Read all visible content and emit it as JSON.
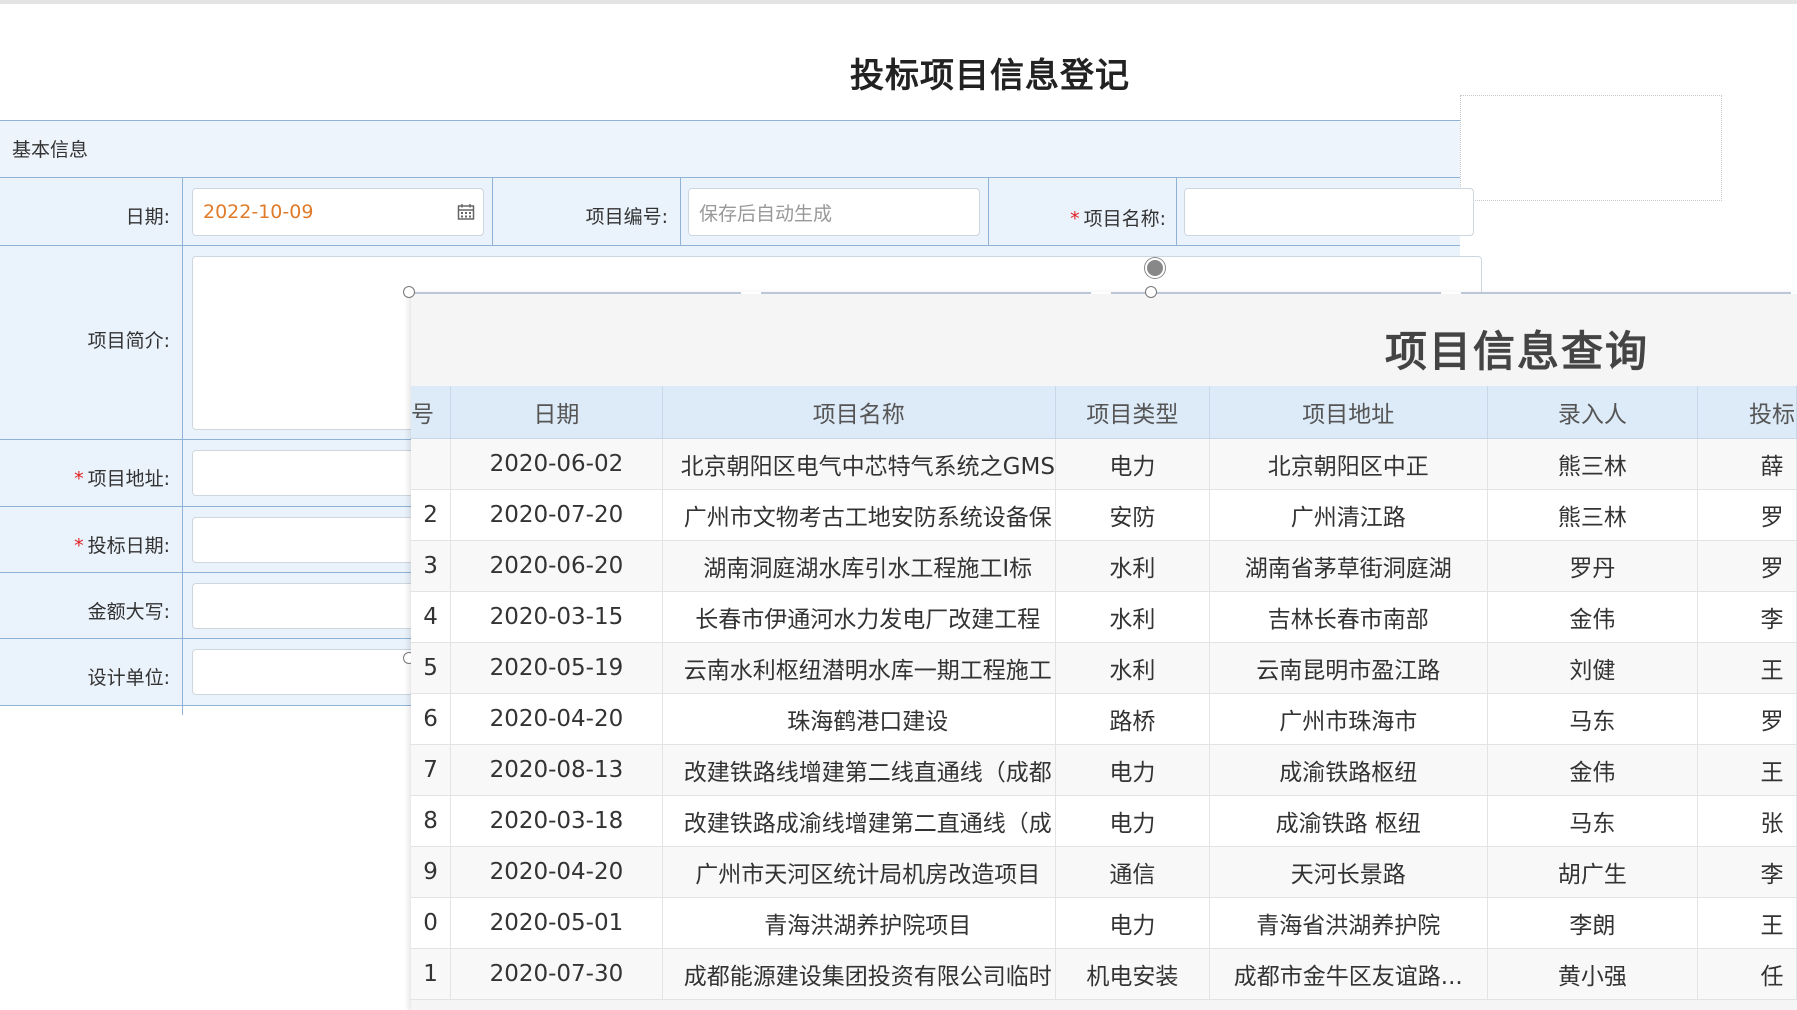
{
  "form": {
    "title": "投标项目信息登记",
    "section_title": "基本信息",
    "date_label": "日期:",
    "date_value": "2022-10-09",
    "code_label": "项目编号:",
    "code_placeholder": "保存后自动生成",
    "name_required": "*",
    "name_label": "项目名称:",
    "summary_label": "项目简介:",
    "address_required": "*",
    "address_label": "项目地址:",
    "bid_date_required": "*",
    "bid_date_label": "投标日期:",
    "amount_label": "金额大写:",
    "design_label": "设计单位:"
  },
  "query": {
    "title": "项目信息查询",
    "columns": [
      "号",
      "日期",
      "项目名称",
      "项目类型",
      "项目地址",
      "录入人",
      "投标"
    ],
    "rows": [
      {
        "num": "",
        "date": "2020-06-02",
        "name": "北京朝阳区电气中芯特气系统之GMS",
        "type": "电力",
        "address": "北京朝阳区中正",
        "person": "熊三林",
        "bidder": "薛"
      },
      {
        "num": "2",
        "date": "2020-07-20",
        "name": "广州市文物考古工地安防系统设备保",
        "type": "安防",
        "address": "广州清江路",
        "person": "熊三林",
        "bidder": "罗"
      },
      {
        "num": "3",
        "date": "2020-06-20",
        "name": "湖南洞庭湖水库引水工程施工Ⅰ标",
        "type": "水利",
        "address": "湖南省茅草街洞庭湖",
        "person": "罗丹",
        "bidder": "罗"
      },
      {
        "num": "4",
        "date": "2020-03-15",
        "name": "长春市伊通河水力发电厂改建工程",
        "type": "水利",
        "address": "吉林长春市南部",
        "person": "金伟",
        "bidder": "李"
      },
      {
        "num": "5",
        "date": "2020-05-19",
        "name": "云南水利枢纽潜明水库一期工程施工",
        "type": "水利",
        "address": "云南昆明市盈江路",
        "person": "刘健",
        "bidder": "王"
      },
      {
        "num": "6",
        "date": "2020-04-20",
        "name": "珠海鹤港口建设",
        "type": "路桥",
        "address": "广州市珠海市",
        "person": "马东",
        "bidder": "罗"
      },
      {
        "num": "7",
        "date": "2020-08-13",
        "name": "改建铁路线增建第二线直通线（成都",
        "type": "电力",
        "address": "成渝铁路枢纽",
        "person": "金伟",
        "bidder": "王"
      },
      {
        "num": "8",
        "date": "2020-03-18",
        "name": "改建铁路成渝线增建第二直通线（成",
        "type": "电力",
        "address": "成渝铁路 枢纽",
        "person": "马东",
        "bidder": "张"
      },
      {
        "num": "9",
        "date": "2020-04-20",
        "name": "广州市天河区统计局机房改造项目",
        "type": "通信",
        "address": "天河长景路",
        "person": "胡广生",
        "bidder": "李"
      },
      {
        "num": "0",
        "date": "2020-05-01",
        "name": "青海洪湖养护院项目",
        "type": "电力",
        "address": "青海省洪湖养护院",
        "person": "李朗",
        "bidder": "王"
      },
      {
        "num": "1",
        "date": "2020-07-30",
        "name": "成都能源建设集团投资有限公司临时",
        "type": "机电安装",
        "address": "成都市金牛区友谊路...",
        "person": "黄小强",
        "bidder": "任"
      }
    ]
  }
}
